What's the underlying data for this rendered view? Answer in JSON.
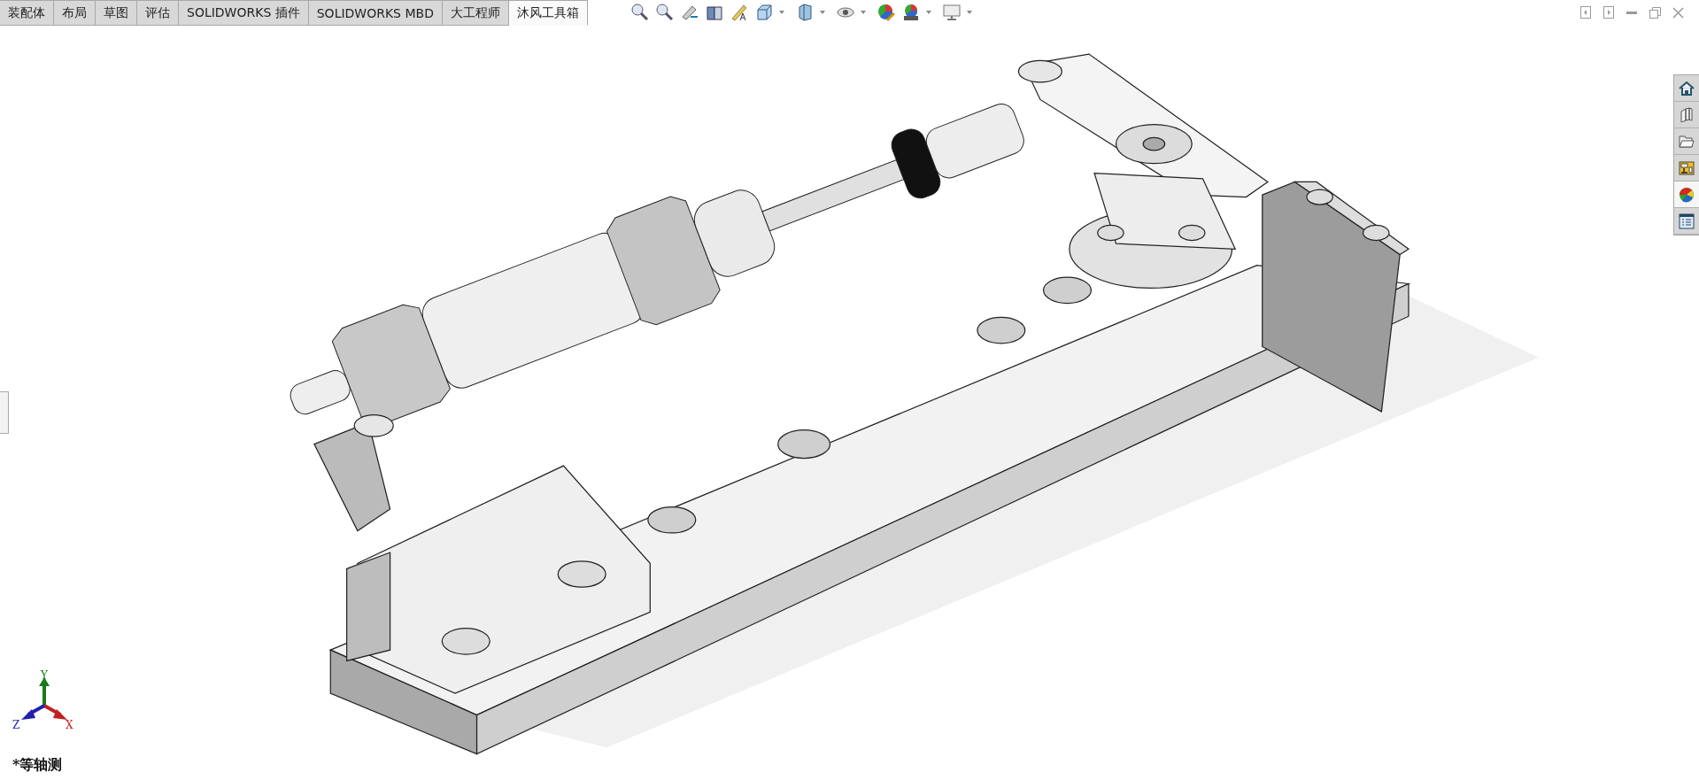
{
  "tabs": [
    {
      "label": "装配体",
      "selected": false
    },
    {
      "label": "布局",
      "selected": false
    },
    {
      "label": "草图",
      "selected": false
    },
    {
      "label": "评估",
      "selected": false
    },
    {
      "label": "SOLIDWORKS 插件",
      "selected": false
    },
    {
      "label": "SOLIDWORKS MBD",
      "selected": false
    },
    {
      "label": "大工程师",
      "selected": false
    },
    {
      "label": "沐风工具箱",
      "selected": true
    }
  ],
  "task_pane": [
    {
      "kind": "home",
      "selected": false
    },
    {
      "kind": "library",
      "selected": false
    },
    {
      "kind": "folder",
      "selected": false
    },
    {
      "kind": "palette",
      "selected": false
    },
    {
      "kind": "appearance",
      "selected": true
    },
    {
      "kind": "properties",
      "selected": false
    }
  ],
  "triad": {
    "x": "X",
    "y": "Y",
    "z": "Z"
  },
  "view_name": "*等轴测"
}
